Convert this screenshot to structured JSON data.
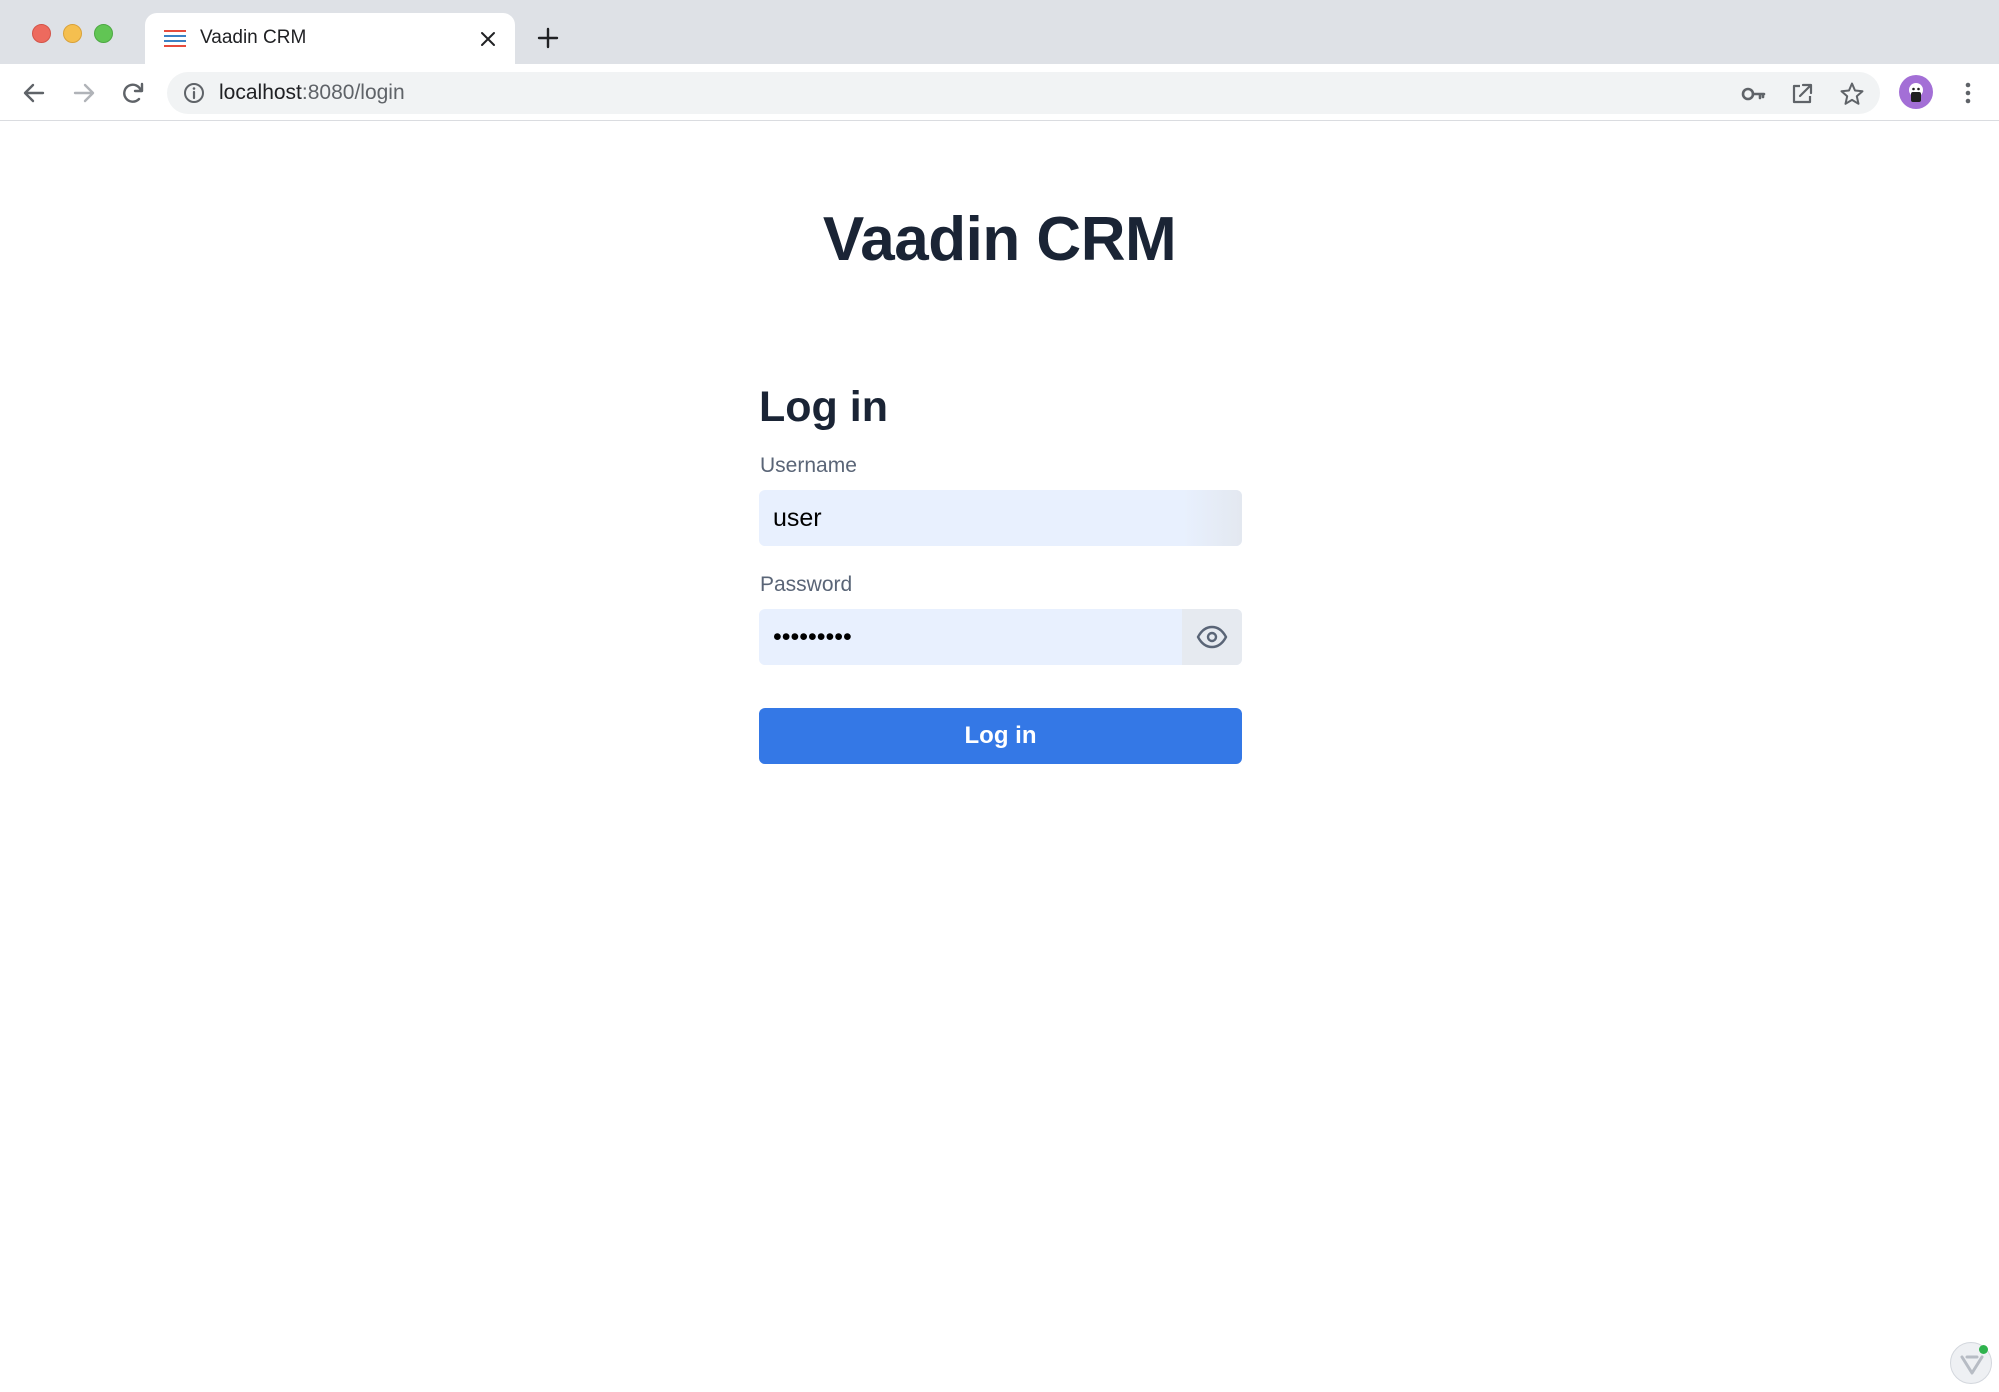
{
  "browser": {
    "tab_title": "Vaadin CRM",
    "url_host": "localhost",
    "url_path": ":8080/login",
    "icons": {
      "back": "back-arrow-icon",
      "forward": "forward-arrow-icon",
      "reload": "reload-icon",
      "site_info": "info-icon",
      "password_key": "key-icon",
      "open_in_app": "open-external-icon",
      "bookmark": "star-icon",
      "menu": "more-vert-icon"
    }
  },
  "page": {
    "app_title": "Vaadin CRM"
  },
  "login": {
    "title": "Log in",
    "username_label": "Username",
    "username_value": "user",
    "password_label": "Password",
    "password_value": "password1",
    "submit_label": "Log in"
  },
  "colors": {
    "primary_button": "#3478e6",
    "autofill_background": "#e8f0fe",
    "heading_text": "#1a2435",
    "label_text": "#5a6577"
  }
}
